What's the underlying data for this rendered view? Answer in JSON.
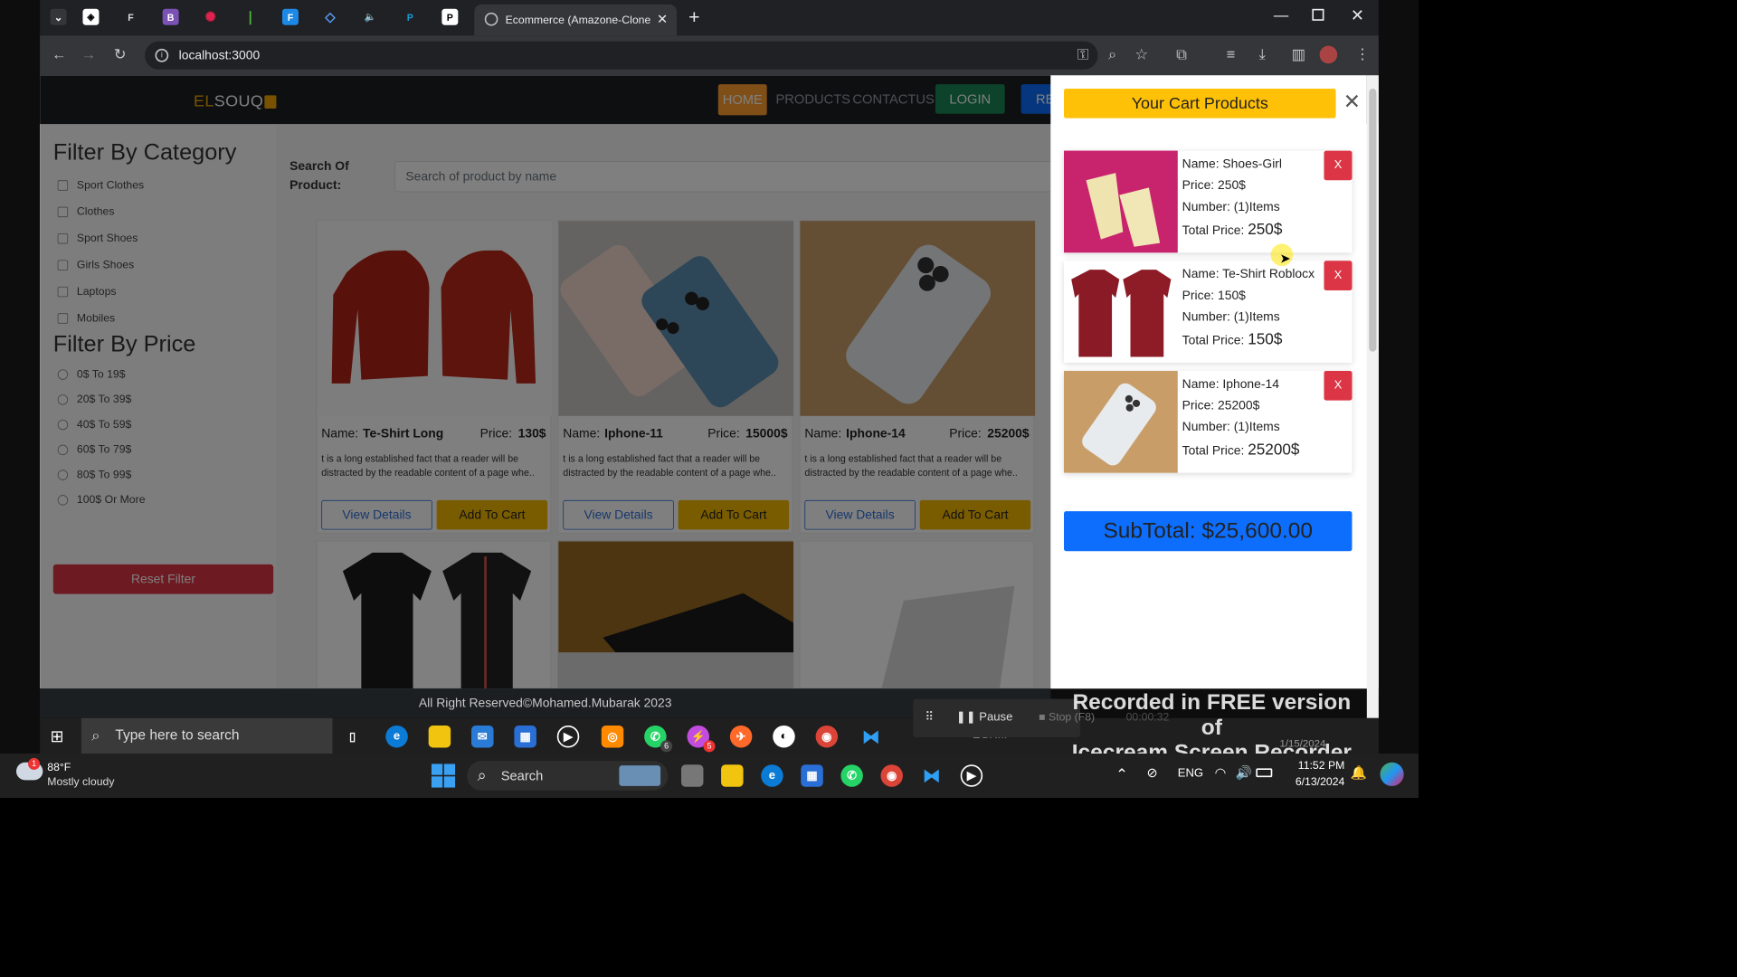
{
  "browser": {
    "active_tab_title": "Ecommerce (Amazone-Clone) A",
    "address": "localhost:3000"
  },
  "nav": {
    "logo_left": "EL",
    "logo_right": "SOUQ",
    "home": "HOME",
    "products": "PRODUCTS",
    "contact": "CONTACTUS",
    "login": "LOGIN",
    "register_partial": "RE"
  },
  "filters": {
    "category_title": "Filter By Category",
    "categories": [
      "Sport Clothes",
      "Clothes",
      "Sport Shoes",
      "Girls Shoes",
      "Laptops",
      "Mobiles"
    ],
    "price_title": "Filter By Price",
    "prices": [
      "0$ To 19$",
      "20$ To 39$",
      "40$ To 59$",
      "60$ To 79$",
      "80$ To 99$",
      "100$ Or More"
    ],
    "reset": "Reset Filter"
  },
  "search": {
    "label": "Search Of Product:",
    "placeholder": "Search of product by name"
  },
  "products": [
    {
      "name_label": "Name:",
      "name": "Te-Shirt Long",
      "price_label": "Price:",
      "price": "130$",
      "desc": "t is a long established fact that a reader will be distracted by the readable content of a page whe..",
      "view": "View Details",
      "add": "Add To Cart"
    },
    {
      "name_label": "Name:",
      "name": "Iphone-11",
      "price_label": "Price:",
      "price": "15000$",
      "desc": "t is a long established fact that a reader will be distracted by the readable content of a page whe..",
      "view": "View Details",
      "add": "Add To Cart"
    },
    {
      "name_label": "Name:",
      "name": "Iphone-14",
      "price_label": "Price:",
      "price": "25200$",
      "desc": "t is a long established fact that a reader will be distracted by the readable content of a page whe..",
      "view": "View Details",
      "add": "Add To Cart"
    }
  ],
  "cart": {
    "title": "Your Cart Products",
    "items": [
      {
        "name": "Name: Shoes-Girl",
        "price": "Price: 250$",
        "number": "Number: (1)Items",
        "total_label": "Total Price:",
        "total": "250$",
        "remove": "X"
      },
      {
        "name": "Name: Te-Shirt Roblocx",
        "price": "Price: 150$",
        "number": "Number: (1)Items",
        "total_label": "Total Price:",
        "total": "150$",
        "remove": "X"
      },
      {
        "name": "Name: Iphone-14",
        "price": "Price: 25200$",
        "number": "Number: (1)Items",
        "total_label": "Total Price:",
        "total": "25200$",
        "remove": "X"
      }
    ],
    "subtotal": "SubTotal: $25,600.00"
  },
  "footer": "All Right Reserved©Mohamed.Mubarak 2023",
  "recorder": {
    "pause": "Pause",
    "stop": "Stop (F8)",
    "time": "00:00:32",
    "watermark_1": "Recorded in FREE version of",
    "watermark_2": "Icecream Screen Recorder",
    "date_behind": "1/15/2024"
  },
  "taskbar_inner": {
    "search": "Type here to search",
    "badge_whatsapp": "6",
    "badge_msg": "5",
    "ghost_label": "EGX..."
  },
  "taskbar": {
    "weather_temp": "88°F",
    "weather_desc": "Mostly cloudy",
    "weather_badge": "1",
    "search": "Search",
    "lang": "ENG",
    "time": "11:52 PM",
    "date": "6/13/2024"
  }
}
